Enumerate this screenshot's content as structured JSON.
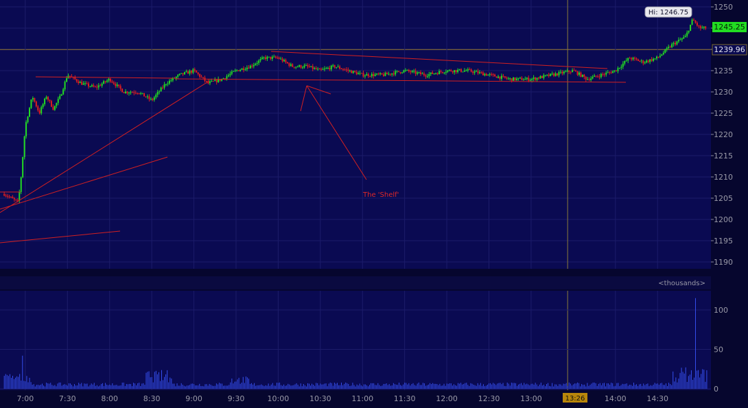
{
  "chart_data": [
    {
      "type": "candlestick",
      "panel": "price",
      "ylim": [
        1188,
        1253
      ],
      "y_ticks": [
        1190,
        1195,
        1200,
        1205,
        1210,
        1215,
        1220,
        1225,
        1230,
        1235,
        1240,
        1245,
        1250
      ],
      "hi_label": "Hi: 1246.75",
      "last_price_label": "1245.25",
      "reference_price": 1239.96,
      "reference_price_label": "1239.96",
      "cursor_time": "13:26",
      "annotation": "The 'Shelf'",
      "price_path": [
        [
          "6:45",
          1206
        ],
        [
          "6:50",
          1205
        ],
        [
          "6:55",
          1204
        ],
        [
          "6:57",
          1210
        ],
        [
          "7:00",
          1222
        ],
        [
          "7:05",
          1229
        ],
        [
          "7:10",
          1225
        ],
        [
          "7:15",
          1229
        ],
        [
          "7:20",
          1226
        ],
        [
          "7:25",
          1229
        ],
        [
          "7:30",
          1234
        ],
        [
          "7:40",
          1232
        ],
        [
          "7:50",
          1231
        ],
        [
          "8:00",
          1233
        ],
        [
          "8:10",
          1230
        ],
        [
          "8:20",
          1230
        ],
        [
          "8:30",
          1228
        ],
        [
          "8:40",
          1232
        ],
        [
          "8:50",
          1234
        ],
        [
          "9:00",
          1235
        ],
        [
          "9:10",
          1232
        ],
        [
          "9:20",
          1233
        ],
        [
          "9:30",
          1235
        ],
        [
          "9:40",
          1236
        ],
        [
          "9:50",
          1238
        ],
        [
          "10:00",
          1238
        ],
        [
          "10:10",
          1236
        ],
        [
          "10:20",
          1236
        ],
        [
          "10:30",
          1235
        ],
        [
          "10:40",
          1236
        ],
        [
          "10:50",
          1235
        ],
        [
          "11:00",
          1234
        ],
        [
          "11:15",
          1234
        ],
        [
          "11:30",
          1235
        ],
        [
          "11:45",
          1234
        ],
        [
          "12:00",
          1235
        ],
        [
          "12:15",
          1235
        ],
        [
          "12:30",
          1234
        ],
        [
          "12:45",
          1233
        ],
        [
          "13:00",
          1233
        ],
        [
          "13:15",
          1234
        ],
        [
          "13:30",
          1235
        ],
        [
          "13:40",
          1233
        ],
        [
          "13:50",
          1234
        ],
        [
          "14:00",
          1235
        ],
        [
          "14:10",
          1238
        ],
        [
          "14:20",
          1237
        ],
        [
          "14:30",
          1238
        ],
        [
          "14:40",
          1241
        ],
        [
          "14:50",
          1243
        ],
        [
          "14:55",
          1247
        ],
        [
          "15:00",
          1245
        ],
        [
          "15:05",
          1245
        ]
      ]
    },
    {
      "type": "bar",
      "panel": "volume",
      "unit_label": "<thousands>",
      "ylim": [
        0,
        120
      ],
      "y_ticks": [
        0,
        50,
        100
      ],
      "x_ticks": [
        "7:00",
        "7:30",
        "8:00",
        "8:30",
        "9:00",
        "9:30",
        "10:00",
        "10:30",
        "11:00",
        "11:30",
        "12:00",
        "12:30",
        "13:00",
        "13:26",
        "14:00",
        "14:30"
      ]
    }
  ]
}
